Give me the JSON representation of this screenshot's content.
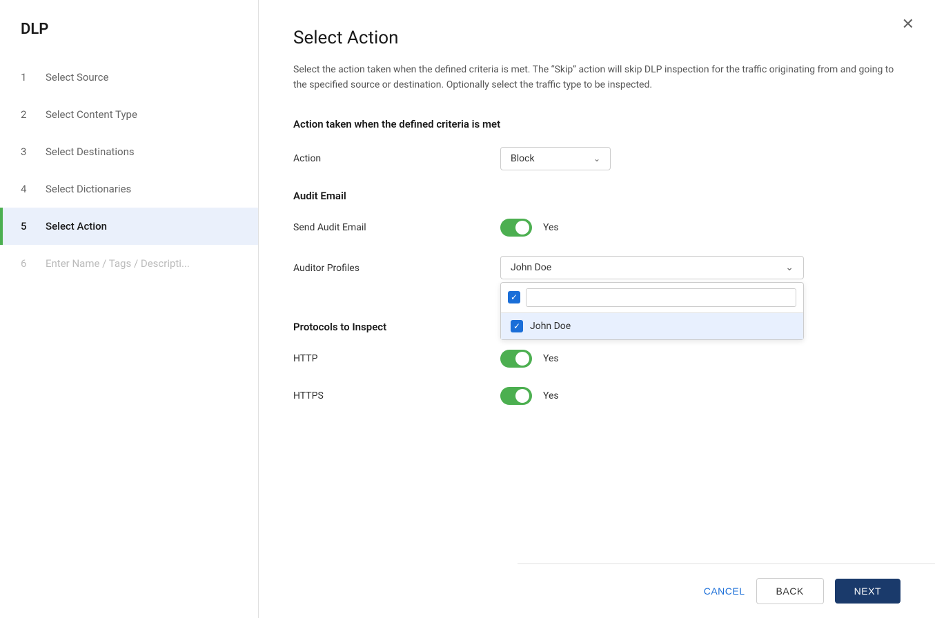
{
  "app": {
    "title": "DLP"
  },
  "sidebar": {
    "items": [
      {
        "step": "1",
        "label": "Select Source",
        "state": "completed"
      },
      {
        "step": "2",
        "label": "Select Content Type",
        "state": "completed"
      },
      {
        "step": "3",
        "label": "Select Destinations",
        "state": "completed"
      },
      {
        "step": "4",
        "label": "Select Dictionaries",
        "state": "completed"
      },
      {
        "step": "5",
        "label": "Select Action",
        "state": "active"
      },
      {
        "step": "6",
        "label": "Enter Name / Tags / Descripti...",
        "state": "dimmed"
      }
    ]
  },
  "main": {
    "title": "Select Action",
    "description": "Select the action taken when the defined criteria is met. The “Skip” action will skip DLP inspection for the traffic originating from and going to the specified source or destination. Optionally select the traffic type to be inspected.",
    "sections": {
      "action_section": {
        "title": "Action taken when the defined criteria is met",
        "action_label": "Action",
        "action_value": "Block"
      },
      "audit_email": {
        "title": "Audit Email",
        "send_label": "Send Audit Email",
        "send_value": "Yes",
        "auditor_label": "Auditor Profiles",
        "auditor_value": "John Doe",
        "dropdown_search_placeholder": "",
        "dropdown_option": "John Doe"
      },
      "protocols": {
        "title": "Protocols to Inspect",
        "http_label": "HTTP",
        "http_value": "Yes",
        "https_label": "HTTPS",
        "https_value": "Yes"
      }
    }
  },
  "footer": {
    "cancel_label": "CANCEL",
    "back_label": "BACK",
    "next_label": "NEXT"
  }
}
